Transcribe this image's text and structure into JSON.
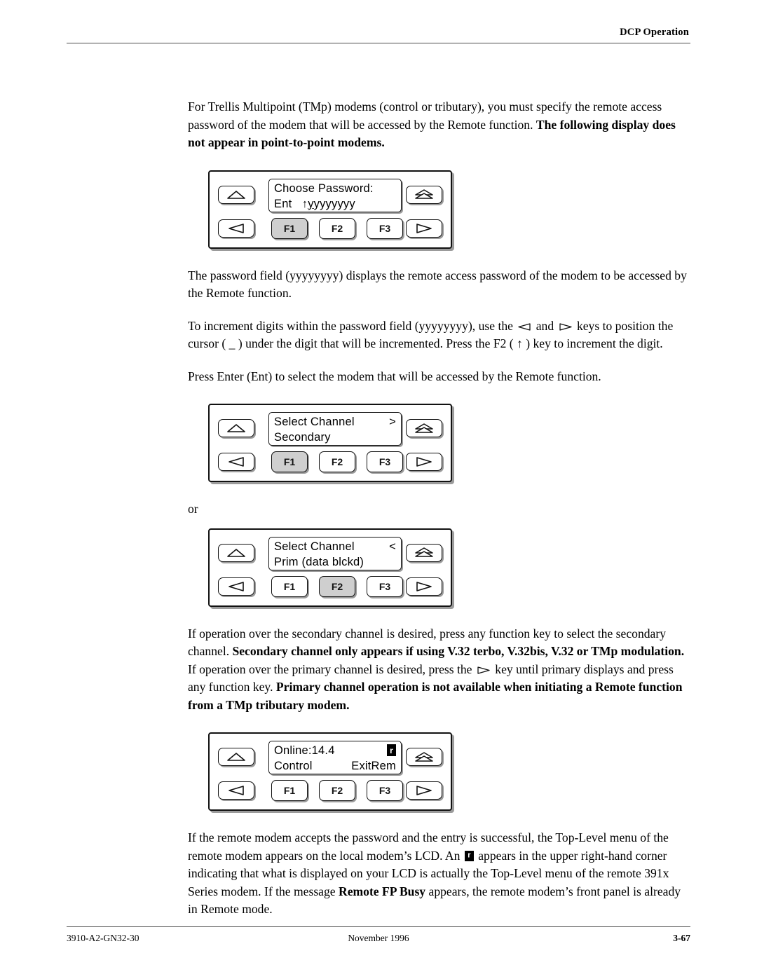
{
  "header": {
    "title": "DCP Operation"
  },
  "footer": {
    "doc_number": "3910-A2-GN32-30",
    "date": "November 1996",
    "page_number": "3-67"
  },
  "paragraphs": {
    "p1_part1": "For Trellis Multipoint (TMp) modems (control or tributary), you must specify the remote access password of the modem that will be accessed by the Remote function. ",
    "p1_bold": "The following display does not appear in point-to-point modems.",
    "p2": "The password field (yyyyyyyy) displays the remote access password of the modem to be accessed by the Remote function.",
    "p3_a": "To increment digits within the password field (yyyyyyyy), use the ",
    "p3_b": " and ",
    "p3_c": " keys to position the cursor ( _ ) under the digit that will be incremented. Press the F2 ( ↑ ) key to increment the digit.",
    "p4": "Press Enter (Ent) to select the modem that will be accessed by the Remote function.",
    "or": "or",
    "p5_a": "If operation over the secondary channel is desired, press any function key to select the secondary channel. ",
    "p5_bold1": "Secondary channel only appears if using V.32 terbo, V.32bis, V.32 or TMp modulation.",
    "p5_b": " If operation over the primary channel is desired, press the ",
    "p5_c": " key until primary displays and press any function key. ",
    "p5_bold2": "Primary channel operation is not available when initiating a Remote function from a TMp tributary modem.",
    "p6_a": "If the remote modem accepts the password and the entry is successful, the Top-Level menu of the remote modem appears on the local modem’s LCD. An ",
    "p6_b": " appears in the upper right-hand corner indicating that what is displayed on your LCD is actually the Top-Level menu of the remote 391x Series modem. If the message ",
    "p6_bold": "Remote FP Busy",
    "p6_c": " appears, the remote modem’s front panel is already in Remote mode."
  },
  "keys": {
    "f1": "F1",
    "f2": "F2",
    "f3": "F3"
  },
  "panels": [
    {
      "id": "choose-password",
      "line1_left": "Choose Password:",
      "line1_right": "",
      "line2_left": "Ent",
      "line2_mid": "↑",
      "line2_cursor_char": "y",
      "line2_rest": "yyyyyyy",
      "line2_right": "",
      "pressed_key": "F1",
      "has_remote_icon": false
    },
    {
      "id": "select-channel-secondary",
      "line1_left": "Select Channel",
      "line1_right": ">",
      "line2_left": "Secondary",
      "line2_right": "",
      "pressed_key": "F1",
      "has_remote_icon": false
    },
    {
      "id": "select-channel-primary",
      "line1_left": "Select Channel",
      "line1_right": "<",
      "line2_left": "Prim (data blckd)",
      "line2_right": "",
      "pressed_key": "F2",
      "has_remote_icon": false
    },
    {
      "id": "online-top-level",
      "line1_left": "Online:14.4",
      "line1_right": "",
      "line2_left": "Control",
      "line2_right": "ExitRem",
      "pressed_key": "",
      "has_remote_icon": true
    }
  ],
  "icons": {
    "up_arrow": "up-triangle-icon",
    "left_arrow": "left-triangle-icon",
    "right_arrow": "right-triangle-icon",
    "double_up_arrow": "double-up-triangle-icon",
    "remote_indicator": "remote-r-indicator-icon"
  }
}
